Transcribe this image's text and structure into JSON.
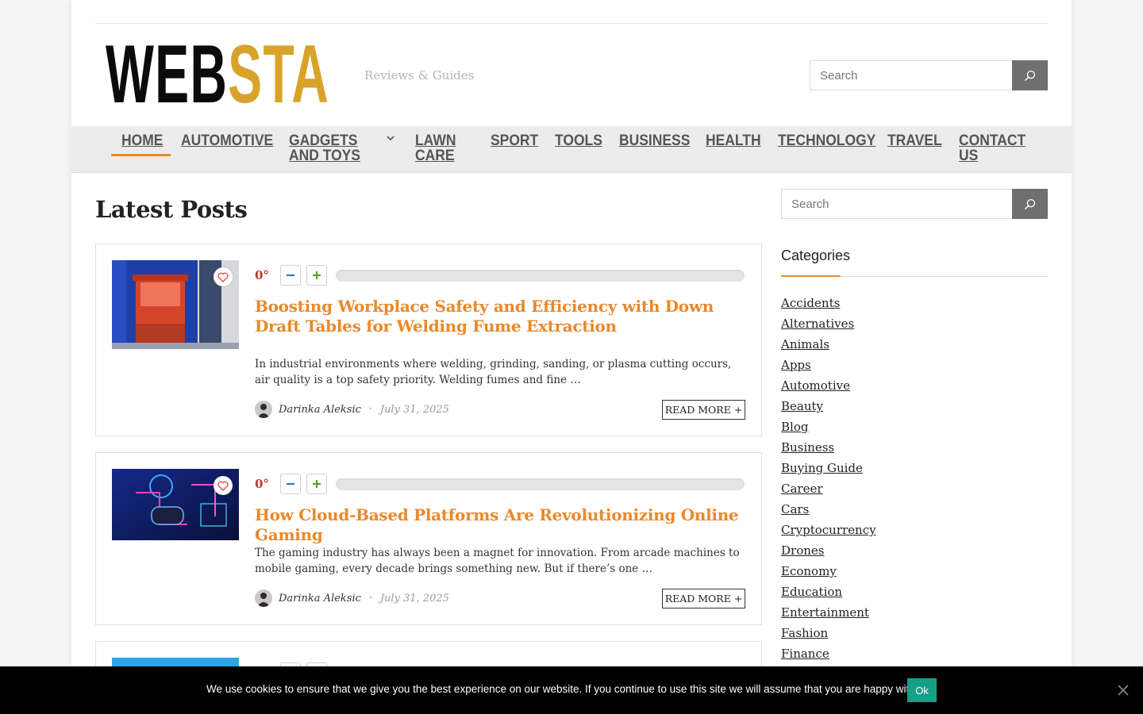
{
  "header": {
    "logo_part1": "WEB",
    "logo_part2": "STA",
    "tagline": "Reviews & Guides",
    "search_placeholder": "Search"
  },
  "nav": {
    "items": [
      "HOME",
      "AUTOMOTIVE",
      "GADGETS AND TOYS",
      "LAWN CARE",
      "SPORT",
      "TOOLS",
      "BUSINESS",
      "HEALTH",
      "TECHNOLOGY",
      "TRAVEL",
      "CONTACT US"
    ],
    "active": "HOME"
  },
  "main": {
    "title": "Latest Posts",
    "posts": [
      {
        "score": "0°",
        "title": "Boosting Workplace Safety and Efficiency with Down Draft Tables for Welding Fume Extraction",
        "excerpt": "In industrial environments where welding, grinding, sanding, or plasma cutting occurs, air quality is a top safety priority. Welding fumes and fine …",
        "author": "Darinka Aleksic",
        "date": "July 31, 2025",
        "read_more": "READ MORE +"
      },
      {
        "score": "0°",
        "title": "How Cloud-Based Platforms Are Revolutionizing Online Gaming",
        "excerpt": "The gaming industry has always been a magnet for innovation. From arcade machines to mobile gaming, every decade brings something new. But if there’s one …",
        "author": "Darinka Aleksic",
        "date": "July 31, 2025",
        "read_more": "READ MORE +"
      }
    ]
  },
  "sidebar": {
    "search_placeholder": "Search",
    "categories_title": "Categories",
    "categories": [
      "Accidents",
      "Alternatives",
      "Animals",
      "Apps",
      "Automotive",
      "Beauty",
      "Blog",
      "Business",
      "Buying Guide",
      "Career",
      "Cars",
      "Cryptocurrency",
      "Drones",
      "Economy",
      "Education",
      "Entertainment",
      "Fashion",
      "Finance"
    ]
  },
  "cookie": {
    "text": "We use cookies to ensure that we give you the best experience on our website. If you continue to use this site we will assume that you are happy with it.",
    "ok_label": "Ok"
  },
  "colors": {
    "accent": "#e8892b",
    "logo_gold": "#d9a32a",
    "score_red": "#c0392b",
    "vote_down": "#2b7bbf",
    "vote_up": "#5aa02c",
    "cookie_ok": "#16a085"
  },
  "icons": [
    "search-icon",
    "chevron-down-icon",
    "heart-icon",
    "minus-icon",
    "plus-icon",
    "close-icon"
  ]
}
